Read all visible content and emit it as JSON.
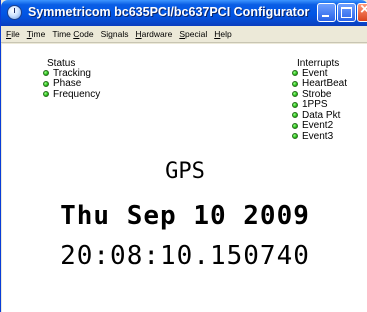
{
  "window": {
    "title": "Symmetricom bc635PCI/bc637PCI Configurator",
    "colors": {
      "titlebar": "#0055e5",
      "led_on": "#2fc21f",
      "client_bg": "#ffffff"
    }
  },
  "menu": [
    {
      "pre": "",
      "mn": "F",
      "post": "ile"
    },
    {
      "pre": "",
      "mn": "T",
      "post": "ime"
    },
    {
      "pre": "Time ",
      "mn": "C",
      "post": "ode"
    },
    {
      "pre": "Si",
      "mn": "g",
      "post": "nals"
    },
    {
      "pre": "",
      "mn": "H",
      "post": "ardware"
    },
    {
      "pre": "",
      "mn": "S",
      "post": "pecial"
    },
    {
      "pre": "",
      "mn": "H",
      "post": "elp"
    }
  ],
  "status": {
    "title": "Status",
    "items": [
      {
        "label": "Tracking",
        "state": "on"
      },
      {
        "label": "Phase",
        "state": "on"
      },
      {
        "label": "Frequency",
        "state": "on"
      }
    ]
  },
  "interrupts": {
    "title": "Interrupts",
    "items": [
      {
        "label": "Event",
        "state": "on"
      },
      {
        "label": "HeartBeat",
        "state": "on"
      },
      {
        "label": "Strobe",
        "state": "on"
      },
      {
        "label": "1PPS",
        "state": "on"
      },
      {
        "label": "Data Pkt",
        "state": "on"
      },
      {
        "label": "Event2",
        "state": "on"
      },
      {
        "label": "Event3",
        "state": "on"
      }
    ]
  },
  "clock": {
    "reference": "GPS",
    "date": "Thu Sep 10 2009",
    "time": "20:08:10.150740"
  }
}
